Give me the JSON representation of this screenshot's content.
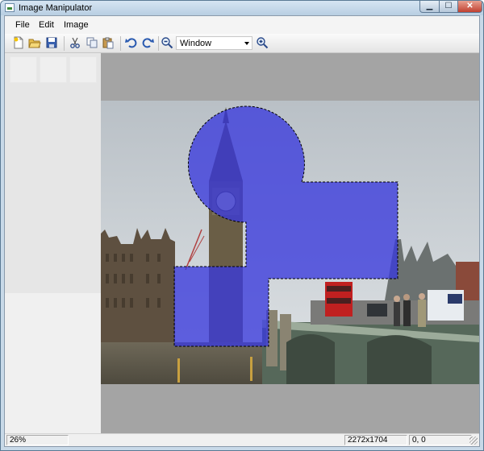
{
  "window": {
    "title": "Image Manipulator",
    "minimize_glyph": "▁",
    "maximize_glyph": "☐",
    "close_glyph": "✕"
  },
  "menu": {
    "items": [
      {
        "label": "File"
      },
      {
        "label": "Edit"
      },
      {
        "label": "Image"
      }
    ]
  },
  "toolbar": {
    "icons": [
      "new-icon",
      "open-icon",
      "save-icon",
      "cut-icon",
      "copy-icon",
      "paste-icon",
      "undo-icon",
      "redo-icon",
      "zoom-out-icon",
      "zoom-in-icon"
    ],
    "zoom_mode": "Window"
  },
  "status": {
    "zoom": "26%",
    "dimensions": "2272x1704",
    "cursor": "0, 0"
  },
  "colors": {
    "selection_fill": "#3a3adc",
    "canvas_bg": "#a4a4a4"
  }
}
